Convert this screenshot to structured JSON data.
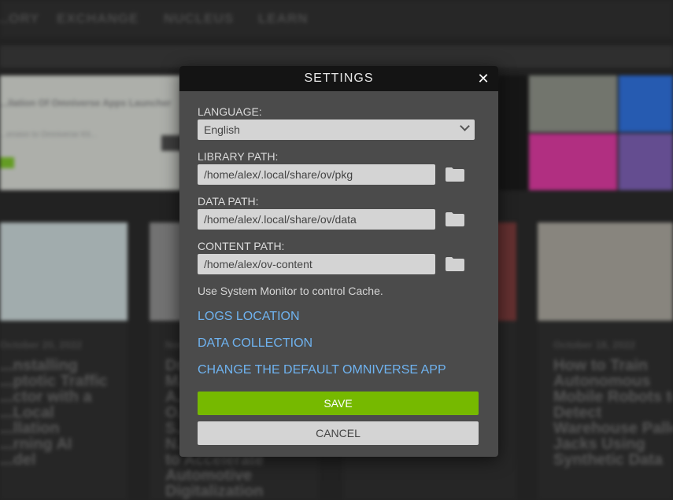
{
  "background": {
    "nav": [
      "...ORY",
      "EXCHANGE",
      "NUCLEUS",
      "LEARN"
    ],
    "banner_text": [
      "...ilation Of Omniverse Apps Launcher",
      "...ension to Omniverse Kit..."
    ],
    "cards": [
      {
        "date": "October 20, 2022",
        "title": "...nstalling\n...ptotic Traffic\n...ctor with a\n...Local\n...llation\n...rning AI\n...del"
      },
      {
        "date": "Nov...",
        "title": "Dri...\nM...\nA...\nO...\nS...\nN...\nto Accelerate\nAutomotive\nDigitalization"
      },
      {
        "date": "October 18, 2022",
        "title": "How to Train\nAutonomous\nMobile Robots to\nDetect\nWarehouse Pallet\nJacks Using\nSynthetic Data"
      }
    ]
  },
  "modal": {
    "title": "SETTINGS",
    "language": {
      "label": "LANGUAGE:",
      "value": "English"
    },
    "library": {
      "label": "LIBRARY PATH:",
      "value": "/home/alex/.local/share/ov/pkg"
    },
    "data": {
      "label": "DATA PATH:",
      "value": "/home/alex/.local/share/ov/data"
    },
    "content": {
      "label": "CONTENT PATH:",
      "value": "/home/alex/ov-content"
    },
    "note": "Use System Monitor to control Cache.",
    "links": {
      "logs": "LOGS LOCATION",
      "collection": "DATA COLLECTION",
      "default_app": "CHANGE THE DEFAULT OMNIVERSE APP"
    },
    "save_label": "SAVE",
    "cancel_label": "CANCEL",
    "icons": {
      "close": "close-icon",
      "folder": "folder-icon",
      "dropdown": "chevron-down-icon"
    }
  },
  "colors": {
    "accent": "#76b900",
    "link": "#6fb3f0",
    "header": "#141414",
    "panel": "#4b4b4b"
  }
}
